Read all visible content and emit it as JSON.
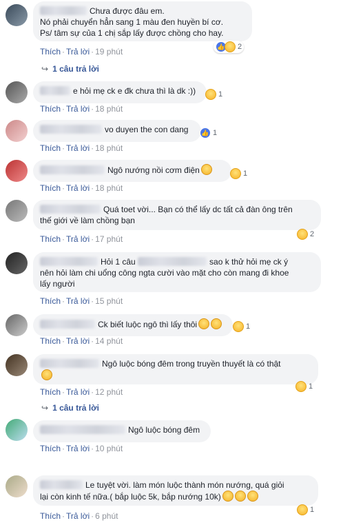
{
  "labels": {
    "like": "Thích",
    "reply": "Trả lời"
  },
  "comments": [
    {
      "lines": [
        "Chưa được đâu em.",
        "Nó phải chuyển hẳn sang 1 màu đen huyền bí cơ.",
        "Ps/ tâm sự của 1 chị sắp lấy được chồng cho hay."
      ],
      "time": "19 phút",
      "reactions": [
        "like",
        "haha"
      ],
      "count": "2",
      "replies": "1 câu trả lời"
    },
    {
      "lines": [
        "e hỏi mẹ ck e đk chưa thì là dk :))"
      ],
      "time": "18 phút",
      "reactions": [
        "haha"
      ],
      "count": "1"
    },
    {
      "lines": [
        "vo duyen the con dang"
      ],
      "time": "18 phút",
      "reactions": [
        "like"
      ],
      "count": "1"
    },
    {
      "lines": [
        "Ngô nướng nồi cơm điện"
      ],
      "time": "18 phút",
      "reactions": [
        "haha"
      ],
      "count": "1"
    },
    {
      "lines": [
        "Quá toet vời... Bạn có thể lấy dc tất cả đàn ông trên",
        "thế giới về làm chồng bạn"
      ],
      "time": "17 phút",
      "reactions": [
        "haha"
      ],
      "count": "2"
    },
    {
      "lines": [
        "Hỏi 1 câu",
        "sao k thử hỏi mẹ ck ý",
        "nên hỏi làm chi uổng công ngta cười vào mặt cho còn mang đi khoe",
        "lấy người"
      ],
      "time": "15 phút"
    },
    {
      "lines": [
        "Ck biết luộc ngô thì lấy thôi"
      ],
      "time": "14 phút",
      "reactions": [
        "haha"
      ],
      "count": "1"
    },
    {
      "lines": [
        "Ngô luộc bóng đêm trong truyền thuyết là có thật"
      ],
      "time": "12 phút",
      "reactions": [
        "haha"
      ],
      "count": "1",
      "replies": "1 câu trả lời"
    },
    {
      "lines": [
        "Ngô luộc bóng đêm"
      ],
      "time": "10 phút"
    },
    {
      "lines": [
        "Le tuyệt vời. làm món luộc thành món nướng, quá giỏi",
        "lại còn kinh tế nữa.( bắp luộc 5k, bắp nướng 10k)"
      ],
      "time": "6 phút",
      "reactions": [
        "haha"
      ],
      "count": "1"
    }
  ]
}
